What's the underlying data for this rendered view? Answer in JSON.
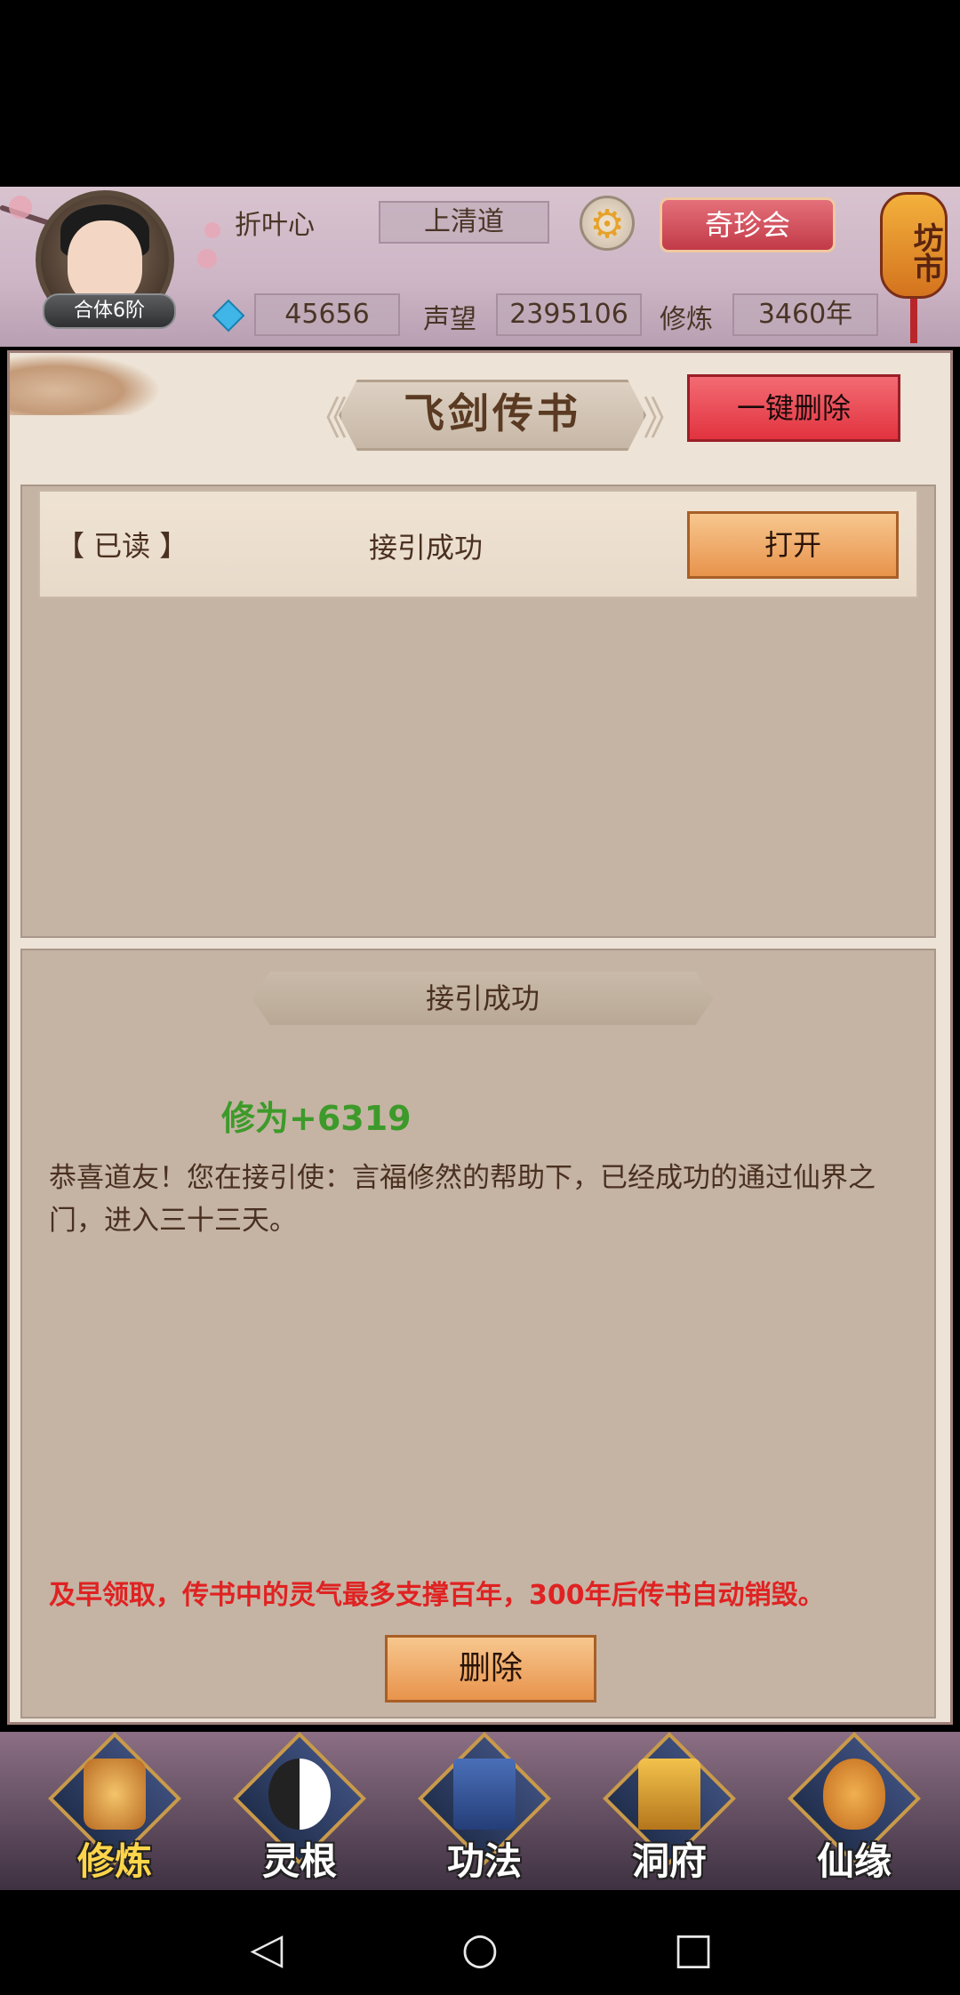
{
  "player": {
    "name": "折叶心",
    "sect": "上清道",
    "rank": "合体6阶",
    "spirit_stones": "45656",
    "reputation_label": "声望",
    "reputation": "2395106",
    "cultivation_label": "修炼",
    "cultivation_years": "3460年"
  },
  "header": {
    "treasure_button": "奇珍会",
    "market_label": "坊市"
  },
  "panel": {
    "title": "飞剑传书",
    "delete_all_button": "一键删除"
  },
  "messages": [
    {
      "status": "【 已读 】",
      "title": "接引成功",
      "open_button": "打开"
    }
  ],
  "detail": {
    "title": "接引成功",
    "reward": "修为+6319",
    "body": "恭喜道友！您在接引使：言福修然的帮助下，已经成功的通过仙界之门，进入三十三天。",
    "warning": "及早领取，传书中的灵气最多支撑百年，300年后传书自动销毁。",
    "delete_button": "删除"
  },
  "bottom_nav": [
    {
      "label": "修炼",
      "icon": "cultivate-icon",
      "active": true
    },
    {
      "label": "灵根",
      "icon": "spirit-root-icon",
      "active": false
    },
    {
      "label": "功法",
      "icon": "technique-book-icon",
      "active": false
    },
    {
      "label": "洞府",
      "icon": "cave-dwelling-icon",
      "active": false
    },
    {
      "label": "仙缘",
      "icon": "immortal-fate-icon",
      "active": false
    }
  ],
  "system_nav": {
    "back": "◁",
    "home": "○",
    "recents": "□"
  },
  "colors": {
    "reward_green": "#3d9a2a",
    "warning_red": "#e02222",
    "delete_all_red": "#e1333f",
    "action_orange": "#e8934c"
  }
}
